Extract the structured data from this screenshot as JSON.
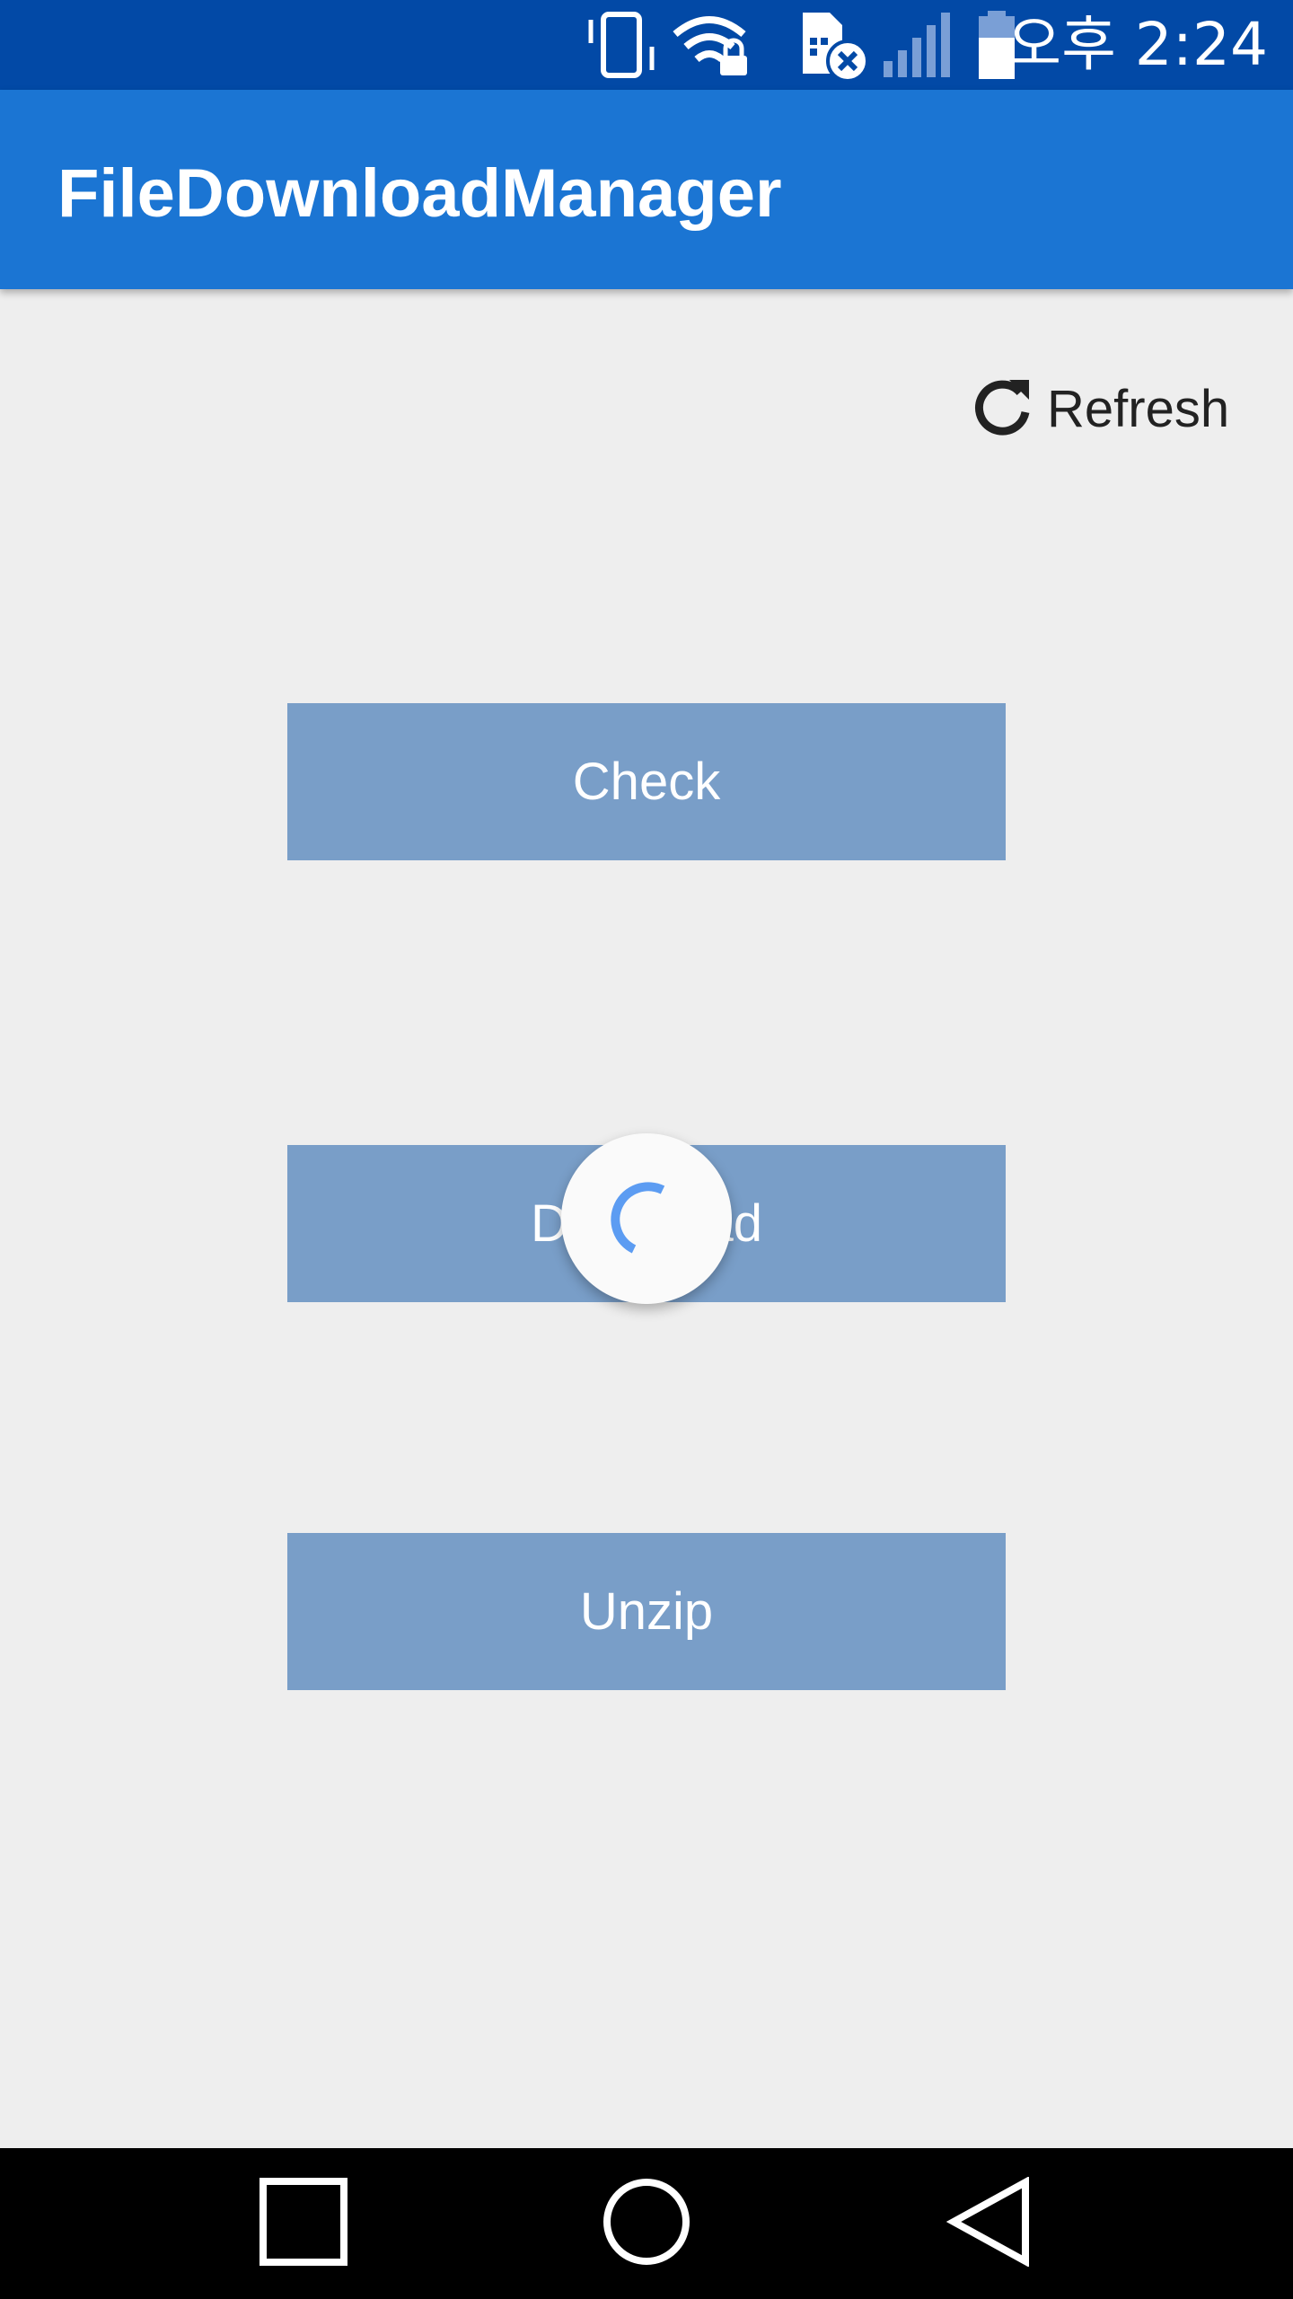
{
  "status_bar": {
    "time": "오후 2:24",
    "icons": [
      "vibrate-icon",
      "wifi-lock-icon",
      "sim-error-icon",
      "signal-icon",
      "battery-icon"
    ]
  },
  "app_bar": {
    "title": "FileDownloadManager",
    "color": "#1b75d3"
  },
  "refresh": {
    "icon": "refresh-icon",
    "label": "Refresh"
  },
  "buttons": {
    "check_label": "Check",
    "download_label": "Download",
    "unzip_label": "Unzip",
    "color": "#799ec8"
  },
  "spinner": {
    "icon": "loading-spinner-icon",
    "accent": "#5c9cf2"
  },
  "nav_bar": {
    "items": [
      "recent-apps-icon",
      "home-icon",
      "back-icon"
    ]
  }
}
